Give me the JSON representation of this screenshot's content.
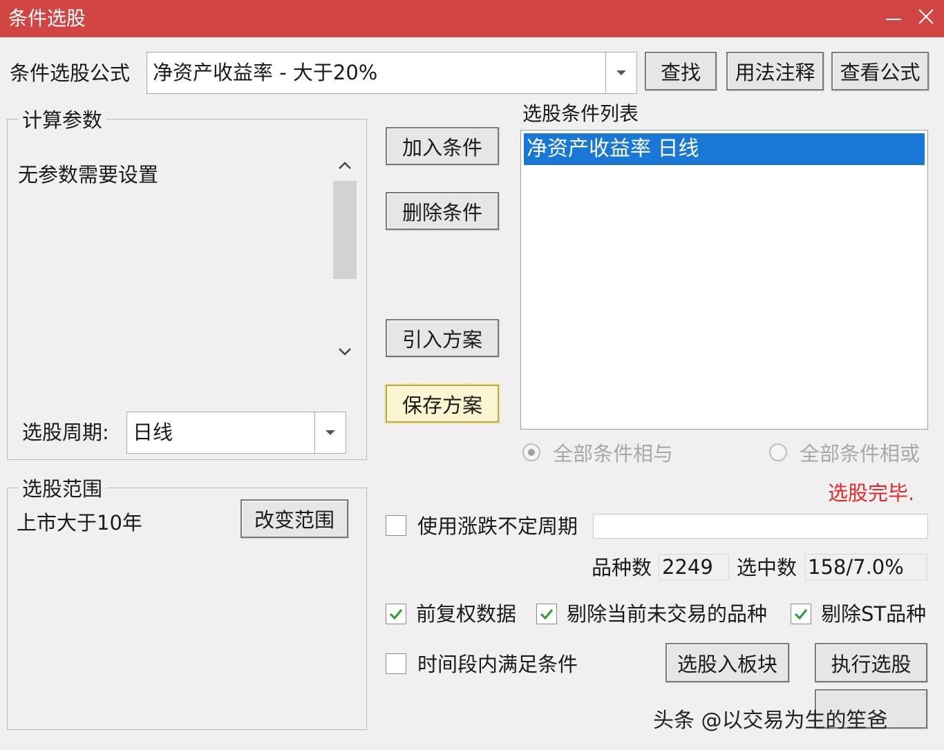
{
  "window": {
    "title": "条件选股",
    "minimize_icon": "minimize-icon",
    "close_icon": "close-icon"
  },
  "formula": {
    "label": "条件选股公式",
    "selected": "净资产收益率 - 大于20%",
    "buttons": {
      "find": "查找",
      "usage_notes": "用法注释",
      "view_formula": "查看公式"
    }
  },
  "calc_params": {
    "group_title": "计算参数",
    "message": "无参数需要设置"
  },
  "period": {
    "label": "选股周期:",
    "selected": "日线"
  },
  "range": {
    "group_title": "选股范围",
    "value": "上市大于10年",
    "change_button": "改变范围"
  },
  "middle_buttons": {
    "add": "加入条件",
    "delete": "删除条件",
    "import": "引入方案",
    "save": "保存方案"
  },
  "condition_list": {
    "title": "选股条件列表",
    "items": [
      "净资产收益率  日线"
    ]
  },
  "logic": {
    "and_label": "全部条件相与",
    "or_label": "全部条件相或",
    "selected": "and"
  },
  "status": {
    "text": "选股完毕.",
    "color": "#e02a2a"
  },
  "uncertain_period": {
    "label": "使用涨跌不定周期",
    "checked": false,
    "value": ""
  },
  "counts": {
    "variety_label": "品种数",
    "variety_value": "2249",
    "selected_label": "选中数",
    "selected_value": "158/7.0%"
  },
  "options": [
    {
      "label": "前复权数据",
      "checked": true
    },
    {
      "label": "剔除当前未交易的品种",
      "checked": true
    },
    {
      "label": "剔除ST品种",
      "checked": true
    }
  ],
  "time_window": {
    "label": "时间段内满足条件",
    "checked": false
  },
  "bottom_buttons": {
    "to_block": "选股入板块",
    "execute": "执行选股"
  },
  "watermark": "头条 @以交易为生的笙爸",
  "colors": {
    "titlebar": "#d24545",
    "selection": "#1977d6",
    "check": "#2a9d2a"
  }
}
